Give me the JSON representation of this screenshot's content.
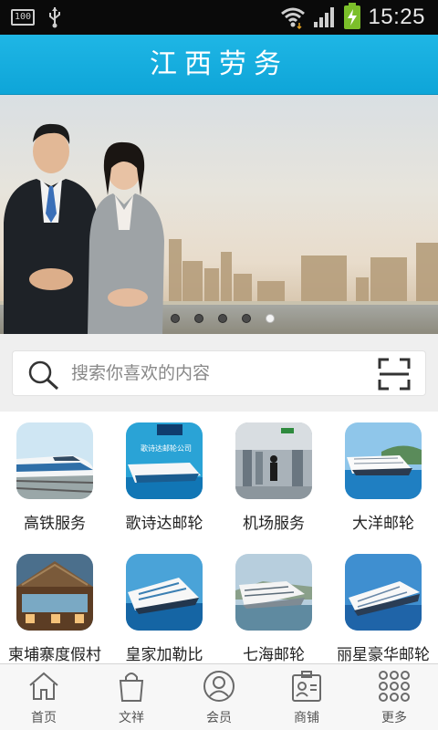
{
  "status_bar": {
    "battery_small": "100",
    "time": "15:25"
  },
  "header": {
    "title": "江西劳务"
  },
  "banner": {
    "slide_count": 5,
    "active_index": 4
  },
  "search": {
    "placeholder": "搜索你喜欢的内容"
  },
  "categories": [
    {
      "label": "高铁服务",
      "icon": "bullet-train"
    },
    {
      "label": "歌诗达邮轮",
      "icon": "cruise-ship"
    },
    {
      "label": "机场服务",
      "icon": "airport"
    },
    {
      "label": "大洋邮轮",
      "icon": "cruise-ship"
    },
    {
      "label": "柬埔寨度假村",
      "icon": "resort"
    },
    {
      "label": "皇家加勒比",
      "icon": "cruise-ship"
    },
    {
      "label": "七海邮轮",
      "icon": "cruise-ship"
    },
    {
      "label": "丽星豪华邮轮",
      "icon": "cruise-ship"
    }
  ],
  "tile_caption": "歌诗达邮轮公司",
  "bottom_nav": [
    {
      "label": "首页",
      "icon": "home-icon"
    },
    {
      "label": "文祥",
      "icon": "shopping-bag-icon"
    },
    {
      "label": "会员",
      "icon": "user-icon"
    },
    {
      "label": "商铺",
      "icon": "id-card-icon"
    },
    {
      "label": "更多",
      "icon": "grid-dots-icon"
    }
  ],
  "colors": {
    "header": "#1fb6e5",
    "status_bar": "#0a0a0a",
    "battery": "#7bbf2a"
  }
}
